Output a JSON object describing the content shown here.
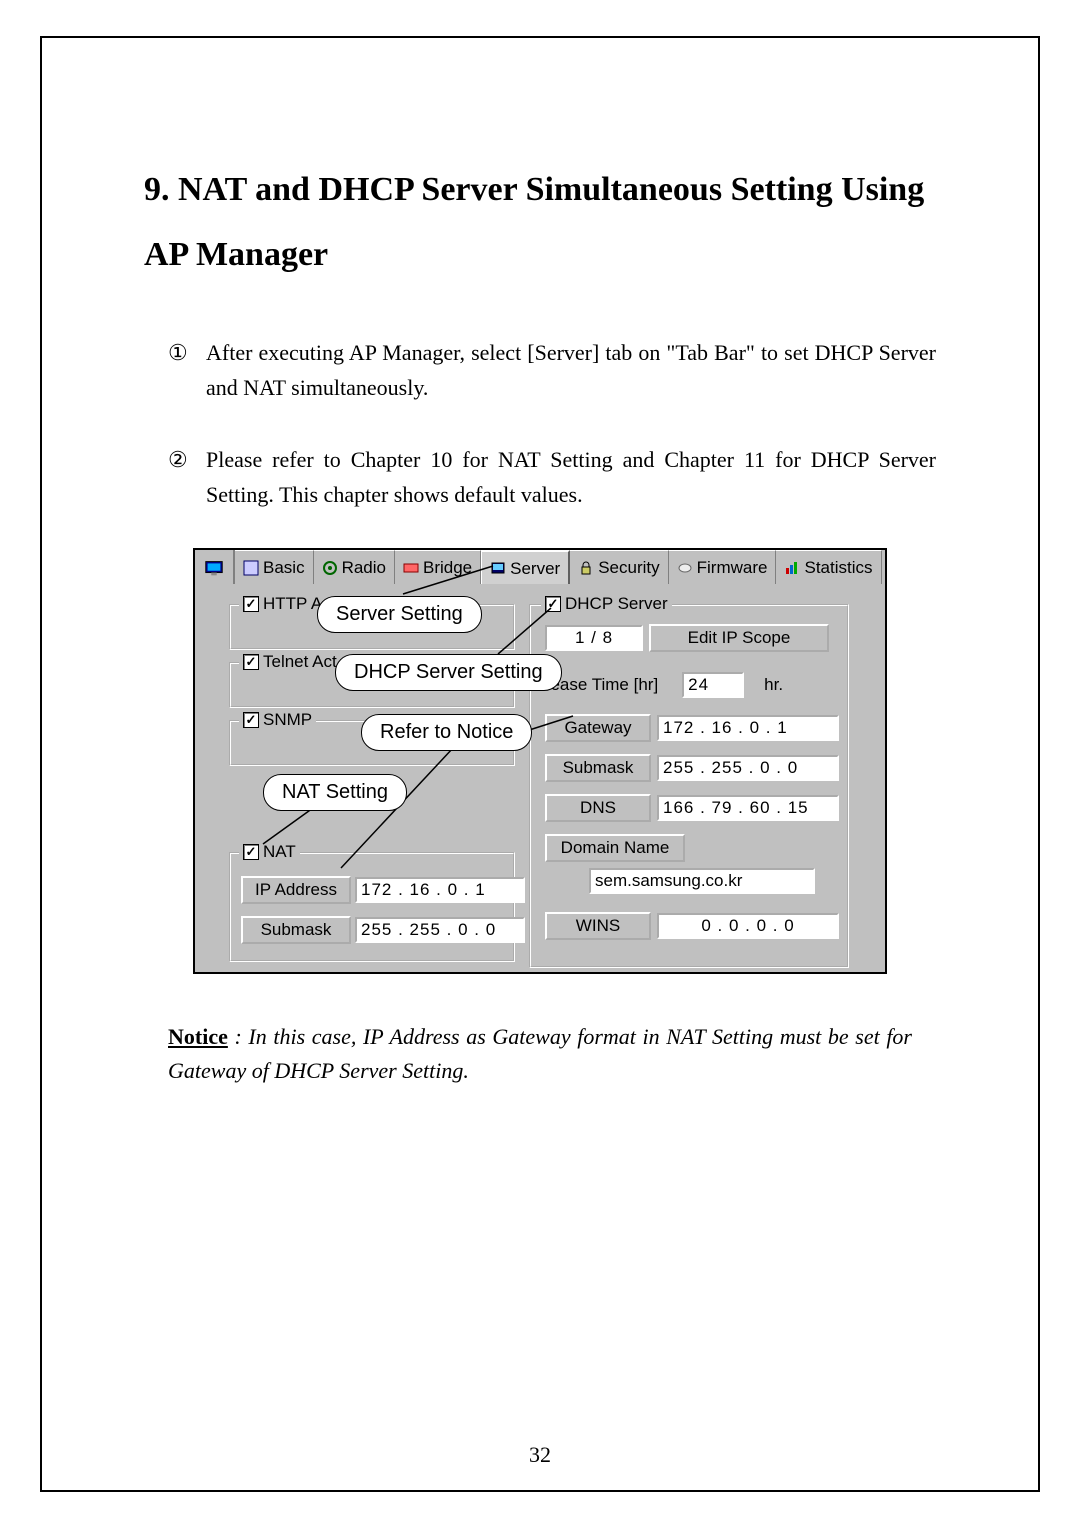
{
  "heading": "9. NAT and DHCP Server Simultaneous Setting Using AP Manager",
  "steps": [
    {
      "num": "①",
      "text": "After executing AP Manager, select [Server] tab on \"Tab Bar\" to set DHCP Server and NAT simultaneously."
    },
    {
      "num": "②",
      "text": "Please refer to Chapter 10 for NAT Setting and Chapter 11 for DHCP Server Setting. This chapter shows default values."
    }
  ],
  "tabs": {
    "basic": "Basic",
    "radio": "Radio",
    "bridge": "Bridge",
    "server": "Server",
    "security": "Security",
    "firmware": "Firmware",
    "statistics": "Statistics"
  },
  "left": {
    "http": "HTTP A",
    "telnet": "Telnet Act",
    "snmp": "SNMP",
    "nat": "NAT",
    "nat_ip_label": "IP Address",
    "nat_ip_value": "172 . 16  .  0  .  1",
    "nat_mask_label": "Submask",
    "nat_mask_value": "255 . 255 .  0  .  0"
  },
  "dhcp": {
    "title": "DHCP Server",
    "scope_count": "1 / 8",
    "edit_scope": "Edit IP Scope",
    "lease_label": "Lease Time [hr]",
    "lease_value": "24",
    "lease_unit": "hr.",
    "gateway_label": "Gateway",
    "gateway_value": "172 . 16  .  0  .  1",
    "submask_label": "Submask",
    "submask_value": "255 . 255 .  0  .  0",
    "dns_label": "DNS",
    "dns_value": "166 . 79  . 60  . 15",
    "domain_label": "Domain Name",
    "domain_value": "sem.samsung.co.kr",
    "wins_label": "WINS",
    "wins_value": "0  .  0  .  0  .  0"
  },
  "callouts": {
    "server": "Server Setting",
    "dhcp": "DHCP Server Setting",
    "notice": "Refer to Notice",
    "nat": "NAT Setting"
  },
  "notice": {
    "label": "Notice",
    "text": " : In this case, IP Address as Gateway format in NAT Setting must be set for Gateway of DHCP Server Setting."
  },
  "page_number": "32"
}
